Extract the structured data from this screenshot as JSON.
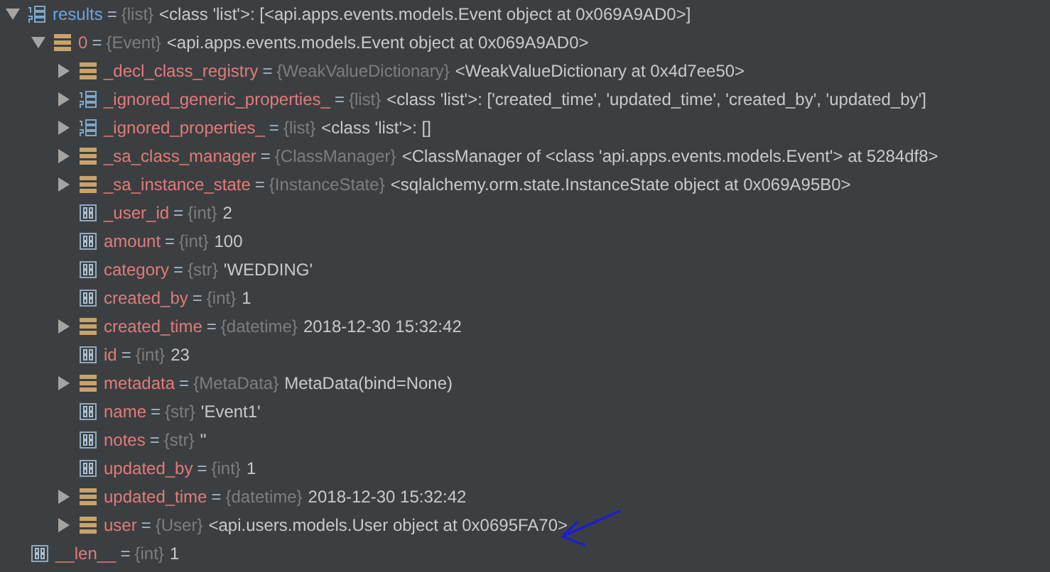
{
  "tree": [
    {
      "name": "results",
      "eq": "=",
      "kind": "list",
      "expanded": true,
      "type": "{list}",
      "value": "<class 'list'>: [<api.apps.events.models.Event object at 0x069A9AD0>]",
      "children": [
        {
          "name": "0",
          "eq": "=",
          "kind": "object",
          "expanded": true,
          "type": "{Event}",
          "value": "<api.apps.events.models.Event object at 0x069A9AD0>",
          "children": [
            {
              "name": "_decl_class_registry",
              "eq": "=",
              "kind": "object",
              "expanded": false,
              "type": "{WeakValueDictionary}",
              "value": "<WeakValueDictionary at 0x4d7ee50>"
            },
            {
              "name": "_ignored_generic_properties_",
              "eq": "=",
              "kind": "list",
              "expanded": false,
              "type": "{list}",
              "value": "<class 'list'>: ['created_time', 'updated_time', 'created_by', 'updated_by']"
            },
            {
              "name": "_ignored_properties_",
              "eq": "=",
              "kind": "list",
              "expanded": false,
              "type": "{list}",
              "value": "<class 'list'>: []"
            },
            {
              "name": "_sa_class_manager",
              "eq": "=",
              "kind": "object",
              "expanded": false,
              "type": "{ClassManager}",
              "value": "<ClassManager of <class 'api.apps.events.models.Event'> at 5284df8>"
            },
            {
              "name": "_sa_instance_state",
              "eq": "=",
              "kind": "object",
              "expanded": false,
              "type": "{InstanceState}",
              "value": "<sqlalchemy.orm.state.InstanceState object at 0x069A95B0>"
            },
            {
              "name": "_user_id",
              "eq": "=",
              "kind": "primitive",
              "type": "{int}",
              "value": "2"
            },
            {
              "name": "amount",
              "eq": "=",
              "kind": "primitive",
              "type": "{int}",
              "value": "100"
            },
            {
              "name": "category",
              "eq": "=",
              "kind": "primitive",
              "type": "{str}",
              "value": "'WEDDING'"
            },
            {
              "name": "created_by",
              "eq": "=",
              "kind": "primitive",
              "type": "{int}",
              "value": "1"
            },
            {
              "name": "created_time",
              "eq": "=",
              "kind": "object",
              "expanded": false,
              "type": "{datetime}",
              "value": "2018-12-30 15:32:42"
            },
            {
              "name": "id",
              "eq": "=",
              "kind": "primitive",
              "type": "{int}",
              "value": "23"
            },
            {
              "name": "metadata",
              "eq": "=",
              "kind": "object",
              "expanded": false,
              "type": "{MetaData}",
              "value": "MetaData(bind=None)"
            },
            {
              "name": "name",
              "eq": "=",
              "kind": "primitive",
              "type": "{str}",
              "value": "'Event1'"
            },
            {
              "name": "notes",
              "eq": "=",
              "kind": "primitive",
              "type": "{str}",
              "value": "''"
            },
            {
              "name": "updated_by",
              "eq": "=",
              "kind": "primitive",
              "type": "{int}",
              "value": "1"
            },
            {
              "name": "updated_time",
              "eq": "=",
              "kind": "object",
              "expanded": false,
              "type": "{datetime}",
              "value": "2018-12-30 15:32:42"
            },
            {
              "name": "user",
              "eq": "=",
              "kind": "object",
              "expanded": false,
              "type": "{User}",
              "value": "<api.users.models.User object at 0x0695FA70>"
            }
          ]
        },
        {
          "name": "__len__",
          "eq": "=",
          "kind": "primitive",
          "type": "{int}",
          "value": "1"
        }
      ]
    }
  ]
}
